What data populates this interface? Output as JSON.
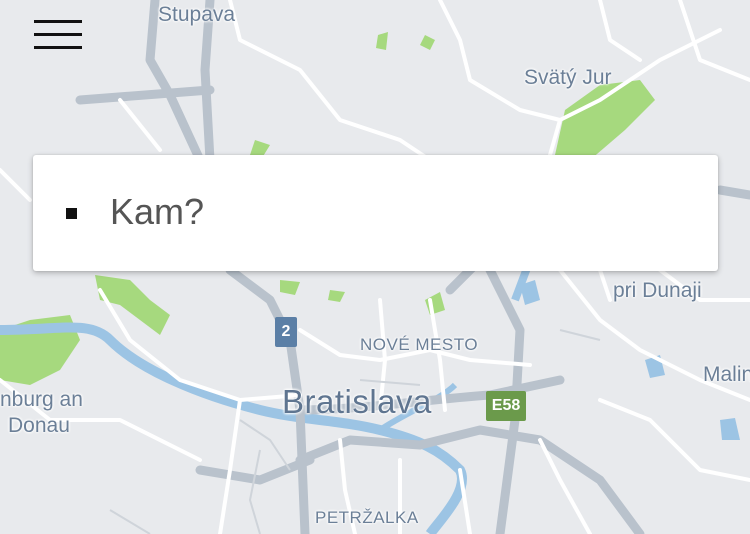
{
  "search": {
    "placeholder": "Kam?"
  },
  "map": {
    "labels": {
      "stupava": "Stupava",
      "svaty_jur": "Svätý Jur",
      "pri_dunaji": "pri Dunaji",
      "hainburg_line1": "nburg an",
      "hainburg_line2": "Donau",
      "nove_mesto": "NOVÉ MESTO",
      "bratislava": "Bratislava",
      "malin": "Malin",
      "petrzalka": "PETRŽALKA"
    },
    "shields": {
      "route_2": "2",
      "e58": "E58"
    },
    "colors": {
      "land": "#e8eaed",
      "green": "#a6d97e",
      "water": "#9cc4e4",
      "highway": "#b9c2cc",
      "road": "#ffffff",
      "label": "#6b7f97"
    }
  },
  "icons": {
    "menu": "hamburger-menu-icon",
    "search_marker": "square-destination-icon"
  }
}
